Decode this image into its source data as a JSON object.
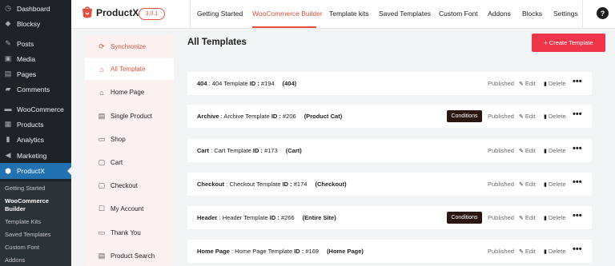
{
  "wp_menu": {
    "items": [
      {
        "label": "Dashboard",
        "icon": "dashboard-icon"
      },
      {
        "label": "Blocksy",
        "icon": "blocksy-icon"
      },
      {
        "label": "Posts",
        "icon": "pin-icon"
      },
      {
        "label": "Media",
        "icon": "media-icon"
      },
      {
        "label": "Pages",
        "icon": "page-icon"
      },
      {
        "label": "Comments",
        "icon": "comment-icon"
      },
      {
        "label": "WooCommerce",
        "icon": "woocommerce-icon"
      },
      {
        "label": "Products",
        "icon": "archive-icon"
      },
      {
        "label": "Analytics",
        "icon": "chart-icon"
      },
      {
        "label": "Marketing",
        "icon": "megaphone-icon"
      },
      {
        "label": "ProductX",
        "icon": "productx-icon"
      }
    ],
    "submenu": [
      "Getting Started",
      "WooCommerce Builder",
      "Template Kits",
      "Saved Templates",
      "Custom Font",
      "Addons"
    ],
    "submenu_current_line1": "WooCommerce",
    "submenu_current_line2": "Builder"
  },
  "header": {
    "logo_text": "ProductX",
    "version": "3.0.1",
    "nav": [
      "Getting Started",
      "WooCommerce Builder",
      "Template kits",
      "Saved Templates",
      "Custom Font",
      "Addons",
      "Blocks",
      "Settings"
    ],
    "help_label": "?"
  },
  "plugin_menu": {
    "sync_label": "Synchronize",
    "items": [
      {
        "label": "All Template",
        "icon": "home-icon"
      },
      {
        "label": "Home Page",
        "icon": "home-page-icon"
      },
      {
        "label": "Single Product",
        "icon": "single-product-icon"
      },
      {
        "label": "Shop",
        "icon": "shop-icon"
      },
      {
        "label": "Cart",
        "icon": "cart-icon"
      },
      {
        "label": "Checkout",
        "icon": "checkout-icon"
      },
      {
        "label": "My Account",
        "icon": "account-icon"
      },
      {
        "label": "Thank You",
        "icon": "thank-you-icon"
      },
      {
        "label": "Product Search",
        "icon": "search-icon"
      }
    ]
  },
  "main": {
    "title": "All Templates",
    "create_button": "+ Create Template",
    "status_label": "Published",
    "edit_label": "Edit",
    "delete_label": "Delete",
    "more_label": "•••",
    "conditions_label": "Conditions",
    "rows": [
      {
        "type": "404",
        "sep": " : ",
        "title": "404 Template",
        "id_label": " ID : ",
        "id": "#194",
        "tag": "(404)",
        "has_conditions": false
      },
      {
        "type": "Archive",
        "sep": " : ",
        "title": "Archive Template",
        "id_label": " ID : ",
        "id": "#206",
        "tag": "(Product Cat)",
        "has_conditions": true
      },
      {
        "type": "Cart",
        "sep": " : ",
        "title": "Cart Template",
        "id_label": " ID : ",
        "id": "#173",
        "tag": "(Cart)",
        "has_conditions": false
      },
      {
        "type": "Checkout",
        "sep": " : ",
        "title": "Checkout Template",
        "id_label": " ID : ",
        "id": "#174",
        "tag": "(Checkout)",
        "has_conditions": false
      },
      {
        "type": "Header",
        "sep": " : ",
        "title": "Header Template",
        "id_label": " ID : ",
        "id": "#266",
        "tag": "(Entire Site)",
        "has_conditions": true
      },
      {
        "type": "Home Page",
        "sep": " : ",
        "title": "Home Page Template",
        "id_label": " ID : ",
        "id": "#169",
        "tag": "(Home Page)",
        "has_conditions": false
      }
    ]
  },
  "colors": {
    "accent": "#e0513f",
    "create_button": "#f0364b",
    "wp_sidebar": "#1d2327",
    "wp_active": "#2271b1"
  }
}
